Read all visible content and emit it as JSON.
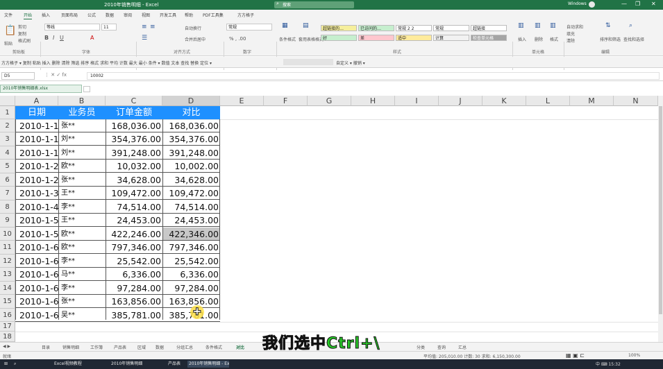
{
  "titlebar": {
    "title": "2010年销售明细 - Excel",
    "search": "搜索",
    "user": "Windows"
  },
  "window_controls": [
    "—",
    "❐",
    "✕"
  ],
  "ribbon_tabs": [
    "文件",
    "开始",
    "插入",
    "页面布局",
    "公式",
    "数据",
    "审阅",
    "视图",
    "开发工具",
    "帮助",
    "PDF工具集",
    "方方格子"
  ],
  "share_label": "共享",
  "ribbon": {
    "paste": "粘贴",
    "cut": "剪切",
    "copy": "复制",
    "format_painter": "格式刷",
    "font_name": "等线",
    "font_size": "11",
    "wrap_text": "自动换行",
    "merge_center": "合并后居中",
    "number_format": "常规",
    "conditional_format": "条件格式",
    "format_as_table": "套用表格格式",
    "styles": [
      {
        "label": "超链接的…",
        "bg": "#f6ef9c"
      },
      {
        "label": "已访问的…",
        "bg": "#c6efce"
      },
      {
        "label": "常规 2 2",
        "bg": "#ffffff"
      },
      {
        "label": "常规",
        "bg": "#ffffff"
      },
      {
        "label": "好",
        "bg": "#c6efce"
      },
      {
        "label": "差",
        "bg": "#ffc7ce"
      },
      {
        "label": "适中",
        "bg": "#ffeb9c"
      },
      {
        "label": "计算",
        "bg": "#f2f2f2"
      },
      {
        "label": "检查单元格",
        "bg": "#a5a5a5"
      },
      {
        "label": "超链接",
        "bg": "#ffffff"
      }
    ],
    "insert": "插入",
    "delete": "删除",
    "format": "格式",
    "autosum": "自动求和",
    "fill": "填充",
    "clear": "清除",
    "sort_filter": "排序和筛选",
    "find_select": "查找和选择",
    "groups": [
      "剪贴板",
      "字体",
      "对齐方式",
      "数字",
      "样式",
      "单元格",
      "编辑"
    ]
  },
  "qat": {
    "left": "方方格子 ▾ 复制 粘贴 插入 删除 清除 筛选 排序 格式 求和 平均 计数 最大 最小 条件 ▾ 数值 文本 查找 替换 定位 ▾",
    "right": "自定义 ▾ 撤销 ▾"
  },
  "formula_bar": {
    "name_box": "D5",
    "icons": "⋮ ✕ ✓ fx",
    "formula": "10002"
  },
  "doc_tab": {
    "label": "2010年销售明细表.xlsx",
    "close": "×"
  },
  "columns": [
    "A",
    "B",
    "C",
    "D",
    "E",
    "F",
    "G",
    "H",
    "I",
    "J",
    "K",
    "L",
    "M",
    "N"
  ],
  "rows": [
    "1",
    "2",
    "3",
    "4",
    "5",
    "6",
    "7",
    "8",
    "9",
    "10",
    "11",
    "12",
    "13",
    "14",
    "15",
    "16",
    "17",
    "18"
  ],
  "table": {
    "headers": [
      "日期",
      "业务员",
      "订单金额",
      "对比"
    ],
    "rows": [
      [
        "2010-1-1",
        "张**",
        "168,036.00",
        "168,036.00"
      ],
      [
        "2010-1-1",
        "刘**",
        "354,376.00",
        "354,376.00"
      ],
      [
        "2010-1-1",
        "刘**",
        "391,248.00",
        "391,248.00"
      ],
      [
        "2010-1-2",
        "欧**",
        "10,032.00",
        "10,002.00"
      ],
      [
        "2010-1-2",
        "张**",
        "34,628.00",
        "34,628.00"
      ],
      [
        "2010-1-3",
        "王**",
        "109,472.00",
        "109,472.00"
      ],
      [
        "2010-1-4",
        "李**",
        "74,514.00",
        "74,514.00"
      ],
      [
        "2010-1-5",
        "王**",
        "24,453.00",
        "24,453.00"
      ],
      [
        "2010-1-5",
        "欧**",
        "422,246.00",
        "422,346.00"
      ],
      [
        "2010-1-6",
        "欧**",
        "797,346.00",
        "797,346.00"
      ],
      [
        "2010-1-6",
        "李**",
        "25,542.00",
        "25,542.00"
      ],
      [
        "2010-1-6",
        "马**",
        "6,336.00",
        "6,336.00"
      ],
      [
        "2010-1-6",
        "李**",
        "97,284.00",
        "97,284.00"
      ],
      [
        "2010-1-6",
        "张**",
        "163,856.00",
        "163,856.00"
      ],
      [
        "2010-1-6",
        "吴**",
        "385,781.00",
        "385,781.00"
      ]
    ],
    "highlighted_row": 9,
    "header_bg": "#1e90ff"
  },
  "sheet_tabs": [
    "目录",
    "销售明细",
    "工作簿",
    "产品表",
    "区域",
    "数据",
    "分组汇总",
    "条件格式",
    "对比",
    "分类",
    "查询",
    "汇总"
  ],
  "active_sheet": "对比",
  "caption": {
    "text": "我们选中",
    "keys": "Ctrl+\\"
  },
  "status": {
    "ready": "就绪",
    "middle": "平均值: 205,010.00  计数: 30  求和: 6,150,300.00",
    "views": "▦ ▣ ⊏",
    "zoom": "100%"
  },
  "taskbar": {
    "items": [
      "Excel视频教程",
      "2010年销售明细",
      "产品表 - Excel",
      "2010年销售明细 - Excel"
    ],
    "tray": "中 ⌨ 15:32"
  }
}
